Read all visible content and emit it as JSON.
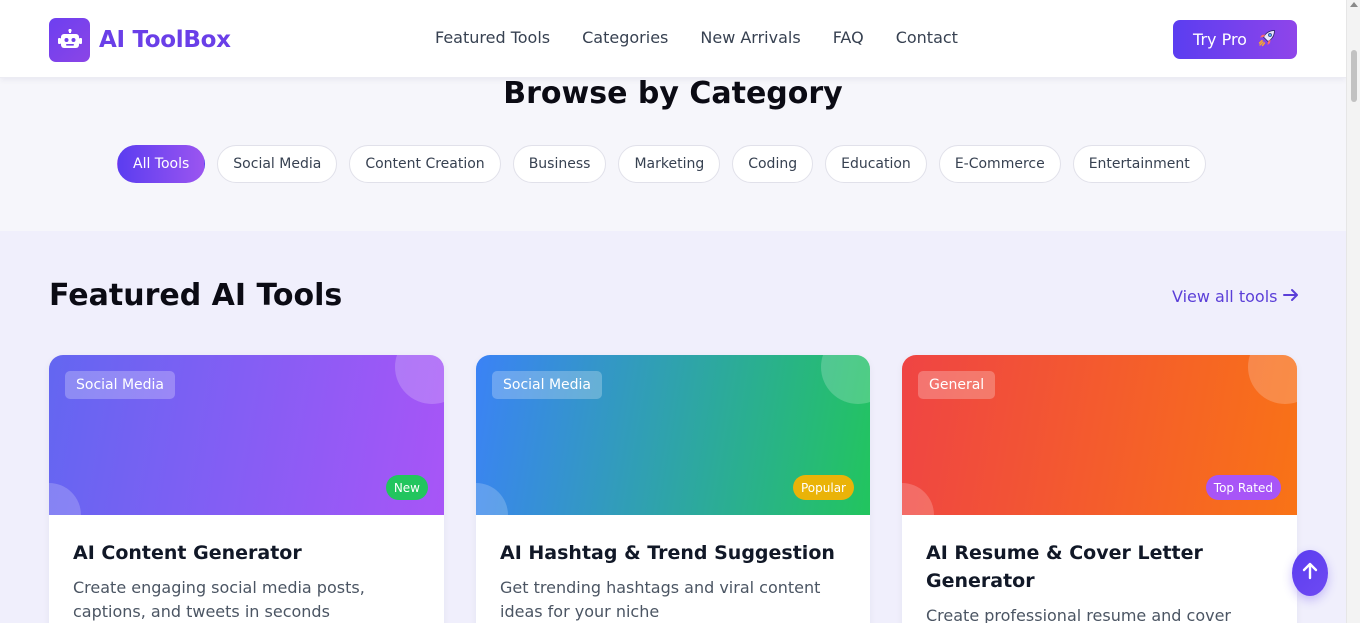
{
  "brand": {
    "name": "AI ToolBox",
    "logo_icon": "robot-icon"
  },
  "nav": {
    "links": [
      "Featured Tools",
      "Categories",
      "New Arrivals",
      "FAQ",
      "Contact"
    ],
    "cta_label": "Try Pro",
    "cta_icon": "rocket-icon"
  },
  "categories": {
    "title": "Browse by Category",
    "pills": [
      "All Tools",
      "Social Media",
      "Content Creation",
      "Business",
      "Marketing",
      "Coding",
      "Education",
      "E-Commerce",
      "Entertainment"
    ],
    "active_index": 0
  },
  "featured": {
    "title": "Featured AI Tools",
    "view_all_label": "View all tools",
    "cards": [
      {
        "category": "Social Media",
        "badge": "New",
        "badge_color": "#22c55e",
        "gradient": [
          "#6366f1",
          "#a855f7"
        ],
        "title": "AI Content Generator",
        "description": "Create engaging social media posts, captions, and tweets in seconds"
      },
      {
        "category": "Social Media",
        "badge": "Popular",
        "badge_color": "#eab308",
        "gradient": [
          "#3b82f6",
          "#22c55e"
        ],
        "title": "AI Hashtag & Trend Suggestion",
        "description": "Get trending hashtags and viral content ideas for your niche"
      },
      {
        "category": "General",
        "badge": "Top Rated",
        "badge_color": "#a855f7",
        "gradient": [
          "#ef4444",
          "#f97316"
        ],
        "title": "AI Resume & Cover Letter Generator",
        "description": "Create professional resume and cover letters"
      }
    ]
  },
  "colors": {
    "brand_primary": "#6a3fe8",
    "accent": "#5b3df0"
  }
}
